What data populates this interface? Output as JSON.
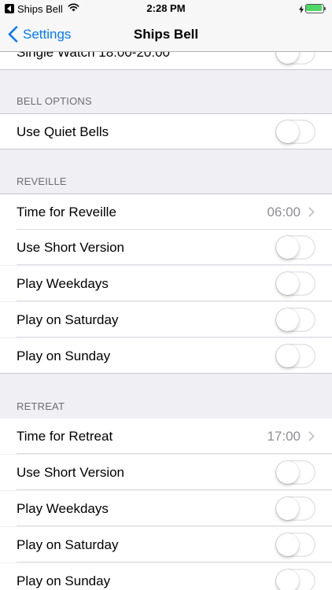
{
  "status_bar": {
    "back_app": "Ships Bell",
    "time": "2:28 PM",
    "icons": [
      "back-triangle-icon",
      "wifi-icon",
      "charging-bolt-icon",
      "battery-icon"
    ],
    "battery_color": "#4cd964"
  },
  "nav": {
    "back_label": "Settings",
    "title": "Ships Bell",
    "tint": "#007aff"
  },
  "partial_row": {
    "label": "Single Watch 18:00-20:00"
  },
  "bell_options": {
    "header": "BELL OPTIONS",
    "rows": [
      {
        "label": "Use Quiet Bells",
        "control": "toggle",
        "on": false
      }
    ]
  },
  "reveille": {
    "header": "REVEILLE",
    "rows": [
      {
        "label": "Time for Reveille",
        "control": "disclosure",
        "value": "06:00"
      },
      {
        "label": "Use Short Version",
        "control": "toggle",
        "on": false
      },
      {
        "label": "Play Weekdays",
        "control": "toggle",
        "on": false
      },
      {
        "label": "Play on Saturday",
        "control": "toggle",
        "on": false
      },
      {
        "label": "Play on Sunday",
        "control": "toggle",
        "on": false
      }
    ]
  },
  "retreat": {
    "header": "RETREAT",
    "rows": [
      {
        "label": "Time for Retreat",
        "control": "disclosure",
        "value": "17:00"
      },
      {
        "label": "Use Short Version",
        "control": "toggle",
        "on": false
      },
      {
        "label": "Play Weekdays",
        "control": "toggle",
        "on": false
      },
      {
        "label": "Play on Saturday",
        "control": "toggle",
        "on": false
      },
      {
        "label": "Play on Sunday",
        "control": "toggle",
        "on": false
      }
    ]
  }
}
